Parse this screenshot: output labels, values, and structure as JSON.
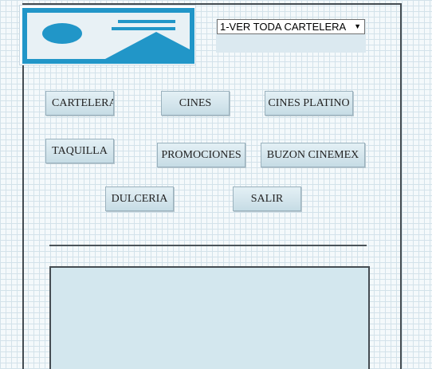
{
  "header": {
    "logo_icon": "image-placeholder-icon",
    "select": {
      "value": "1-VER TODA CARTELERA",
      "arrow_icon": "triangle-down-icon"
    }
  },
  "menu": {
    "cartelera": "CARTELERA",
    "cines": "CINES",
    "cines_platino": "CINES PLATINO",
    "taquilla": "TAQUILLA",
    "promociones": "PROMOCIONES",
    "buzon_cinemex": "BUZON CINEMEX",
    "dulceria": "DULCERIA",
    "salir": "SALIR"
  },
  "colors": {
    "logo_blue": "#2196c8",
    "button_top": "#e4f0f5",
    "button_bottom": "#c6dce5",
    "frame": "#444c52"
  }
}
